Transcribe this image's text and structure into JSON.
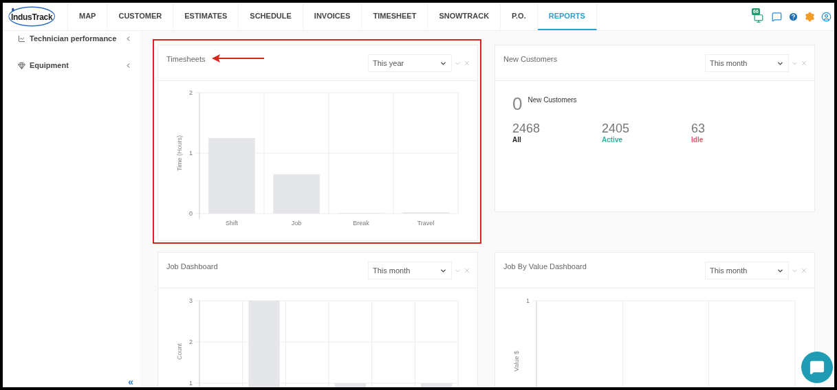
{
  "nav": {
    "logo": "IndusTrack",
    "tabs": [
      {
        "label": "MAP",
        "selected": false
      },
      {
        "label": "CUSTOMER",
        "selected": false
      },
      {
        "label": "ESTIMATES",
        "selected": false
      },
      {
        "label": "SCHEDULE",
        "selected": false
      },
      {
        "label": "INVOICES",
        "selected": false
      },
      {
        "label": "TIMESHEET",
        "selected": false
      },
      {
        "label": "SNOWTRACK",
        "selected": false
      },
      {
        "label": "P.O.",
        "selected": false
      },
      {
        "label": "REPORTS",
        "selected": true
      }
    ],
    "notification_count": "66"
  },
  "sidebar": {
    "items": [
      {
        "label": "Technician performance",
        "expanded": false
      },
      {
        "label": "Equipment",
        "expanded": false
      }
    ],
    "collapse": "«"
  },
  "widgets": [
    {
      "kind": "chart",
      "title": "Timesheets",
      "period": "This year",
      "highlighted": true,
      "chart_data": {
        "type": "bar",
        "ylabel": "Time (Hours)",
        "categories": [
          "Shift",
          "Job",
          "Break",
          "Travel"
        ],
        "values": [
          1.25,
          0.65,
          0,
          0.02
        ],
        "ylim": [
          0,
          2
        ],
        "yticks": [
          0,
          1,
          2
        ]
      }
    },
    {
      "kind": "stats",
      "title": "New Customers",
      "period": "This month",
      "highlighted": false,
      "new_count": "0",
      "new_label": "New Customers",
      "stats": [
        {
          "value": "2468",
          "label": "All",
          "color": "#1f1f1f"
        },
        {
          "value": "2405",
          "label": "Active",
          "color": "#2fb39a"
        },
        {
          "value": "63",
          "label": "Idle",
          "color": "#e0566a"
        }
      ]
    },
    {
      "kind": "chart",
      "title": "Job Dashboard",
      "period": "This month",
      "highlighted": false,
      "chart_data": {
        "type": "bar",
        "ylabel": "Count",
        "values": [
          0,
          3,
          0,
          1,
          0,
          1
        ],
        "ylim": [
          0,
          3
        ],
        "yticks": [
          1,
          2,
          3
        ]
      }
    },
    {
      "kind": "empty_chart",
      "title": "Job By Value Dashboard",
      "period": "This month",
      "highlighted": false,
      "y_tick": "1",
      "y_axis_label": "Value $"
    }
  ]
}
